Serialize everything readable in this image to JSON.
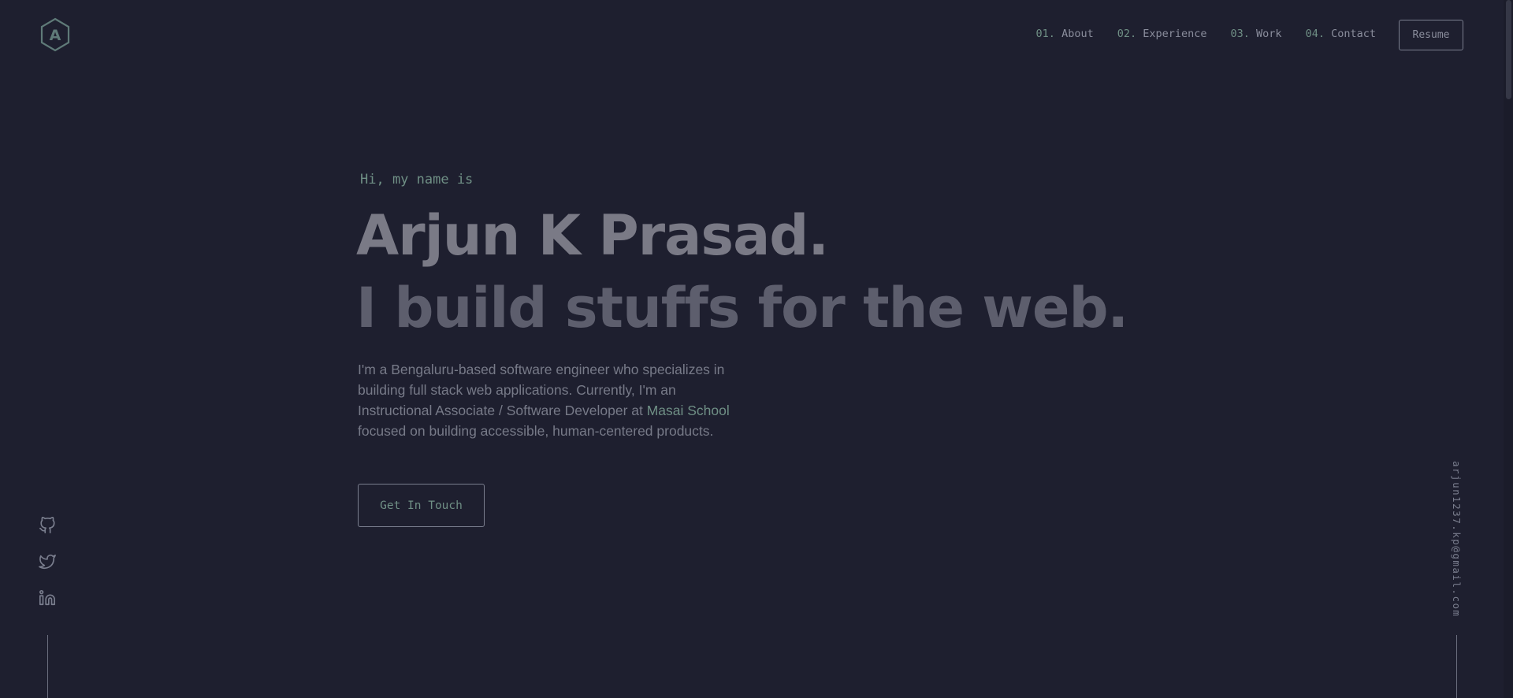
{
  "header": {
    "logo_letter": "A",
    "nav": [
      {
        "num": "01.",
        "label": "About"
      },
      {
        "num": "02.",
        "label": "Experience"
      },
      {
        "num": "03.",
        "label": "Work"
      },
      {
        "num": "04.",
        "label": "Contact"
      }
    ],
    "resume_label": "Resume"
  },
  "hero": {
    "greeting": "Hi, my name is",
    "name": "Arjun K Prasad.",
    "tagline": "I build stuffs for the web.",
    "bio_before": "I'm a Bengaluru-based software engineer who specializes in building full stack web applications. Currently, I'm an Instructional Associate / Software Developer at ",
    "bio_link": "Masai School",
    "bio_after": " focused on building accessible, human-centered products.",
    "cta_label": "Get In Touch"
  },
  "social": {
    "icons": [
      "github-icon",
      "twitter-icon",
      "linkedin-icon"
    ]
  },
  "email": "arjun1237.kp@gmail.com",
  "colors": {
    "background": "#1e1f2f",
    "accent": "#6f8f85",
    "text": "#8a8d9c"
  }
}
